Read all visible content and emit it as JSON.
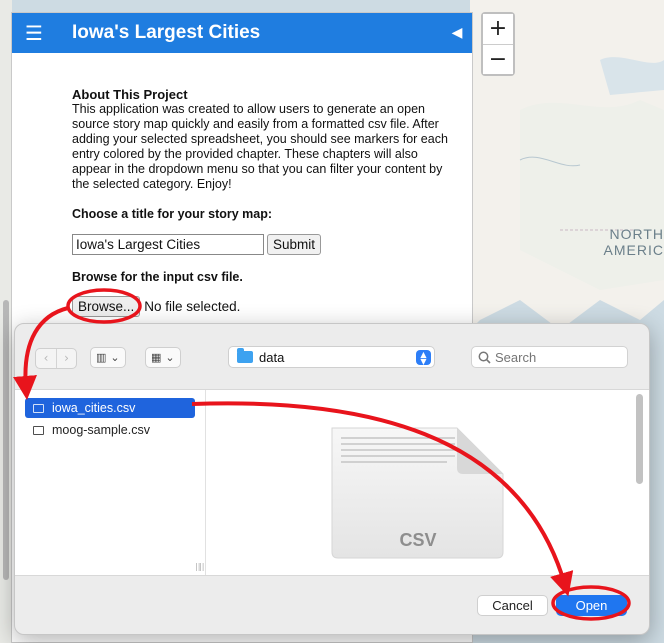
{
  "map": {
    "label_line1": "NORTH",
    "label_line2": "AMERIC"
  },
  "zoom": {
    "in_label": "+",
    "out_label": "−"
  },
  "panel": {
    "menu_icon": "hamburger-icon",
    "title": "Iowa's Largest Cities",
    "collapse_icon": "triangle-left-icon",
    "about_title": "About This Project",
    "about_text": "This application was created to allow users to generate an open source story map quickly and easily from a formatted csv file. After adding your selected spreadsheet, you should see markers for each entry colored by the provided chapter. These chapters will also appear in the dropdown menu so that you can filter your content by the selected category. Enjoy!",
    "title_prompt": "Choose a title for your story map:",
    "title_value": "Iowa's Largest Cities",
    "submit_label": "Submit",
    "browse_prompt": "Browse for the input csv file.",
    "browse_label": "Browse...",
    "file_status": "No file selected."
  },
  "dialog": {
    "back_icon": "chevron-left-icon",
    "forward_icon": "chevron-right-icon",
    "location": "data",
    "search_placeholder": "Search",
    "files": [
      {
        "name": "iowa_cities.csv",
        "selected": true
      },
      {
        "name": "moog-sample.csv",
        "selected": false
      }
    ],
    "preview_type": "CSV",
    "cancel_label": "Cancel",
    "open_label": "Open"
  },
  "colors": {
    "header_blue": "#1f7de0",
    "selection_blue": "#1f64dd",
    "open_blue": "#1f76f0",
    "annotation_red": "#e8141c"
  }
}
